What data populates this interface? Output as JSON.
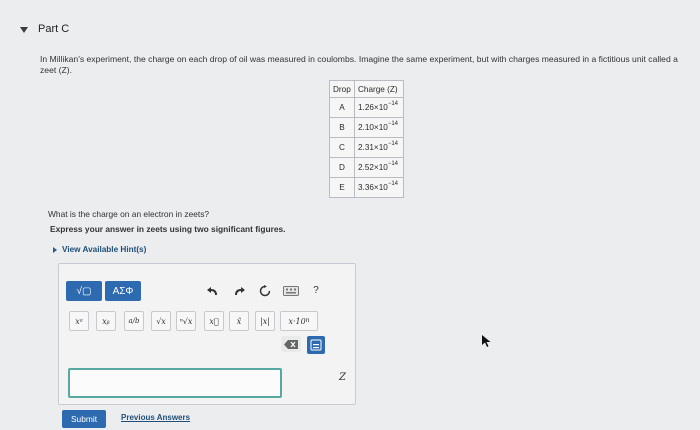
{
  "part": {
    "title": "Part C"
  },
  "problem": {
    "text": "In Millikan's experiment, the charge on each drop of oil was measured in coulombs. Imagine the same experiment, but with charges measured in a fictitious unit called a zeet (Z)."
  },
  "table": {
    "headers": [
      "Drop",
      "Charge (Z)"
    ],
    "rows": [
      {
        "drop": "A",
        "mantissa": "1.26×10",
        "exp": "−14"
      },
      {
        "drop": "B",
        "mantissa": "2.10×10",
        "exp": "−14"
      },
      {
        "drop": "C",
        "mantissa": "2.31×10",
        "exp": "−14"
      },
      {
        "drop": "D",
        "mantissa": "2.52×10",
        "exp": "−14"
      },
      {
        "drop": "E",
        "mantissa": "3.36×10",
        "exp": "−14"
      }
    ]
  },
  "question": "What is the charge on an electron in zeets?",
  "instruction": "Express your answer in zeets using two significant figures.",
  "hints": {
    "label": "View Available Hint(s)"
  },
  "editor": {
    "templates_label": "√▢",
    "symbols_label": "ΑΣΦ",
    "help_label": "?",
    "tools": [
      "xᵃ",
      "xᵦ",
      "a/b",
      "√x",
      "ⁿ√x",
      "x⃗",
      "x̂",
      "|x|",
      "x·10ⁿ"
    ],
    "sci_label": "x·10",
    "sci_exp": "n"
  },
  "answer": {
    "value": "",
    "unit": "Z"
  },
  "buttons": {
    "submit": "Submit",
    "previous": "Previous Answers"
  },
  "colors": {
    "accent": "#2e6ab0",
    "answer_border": "#56a8a1"
  }
}
